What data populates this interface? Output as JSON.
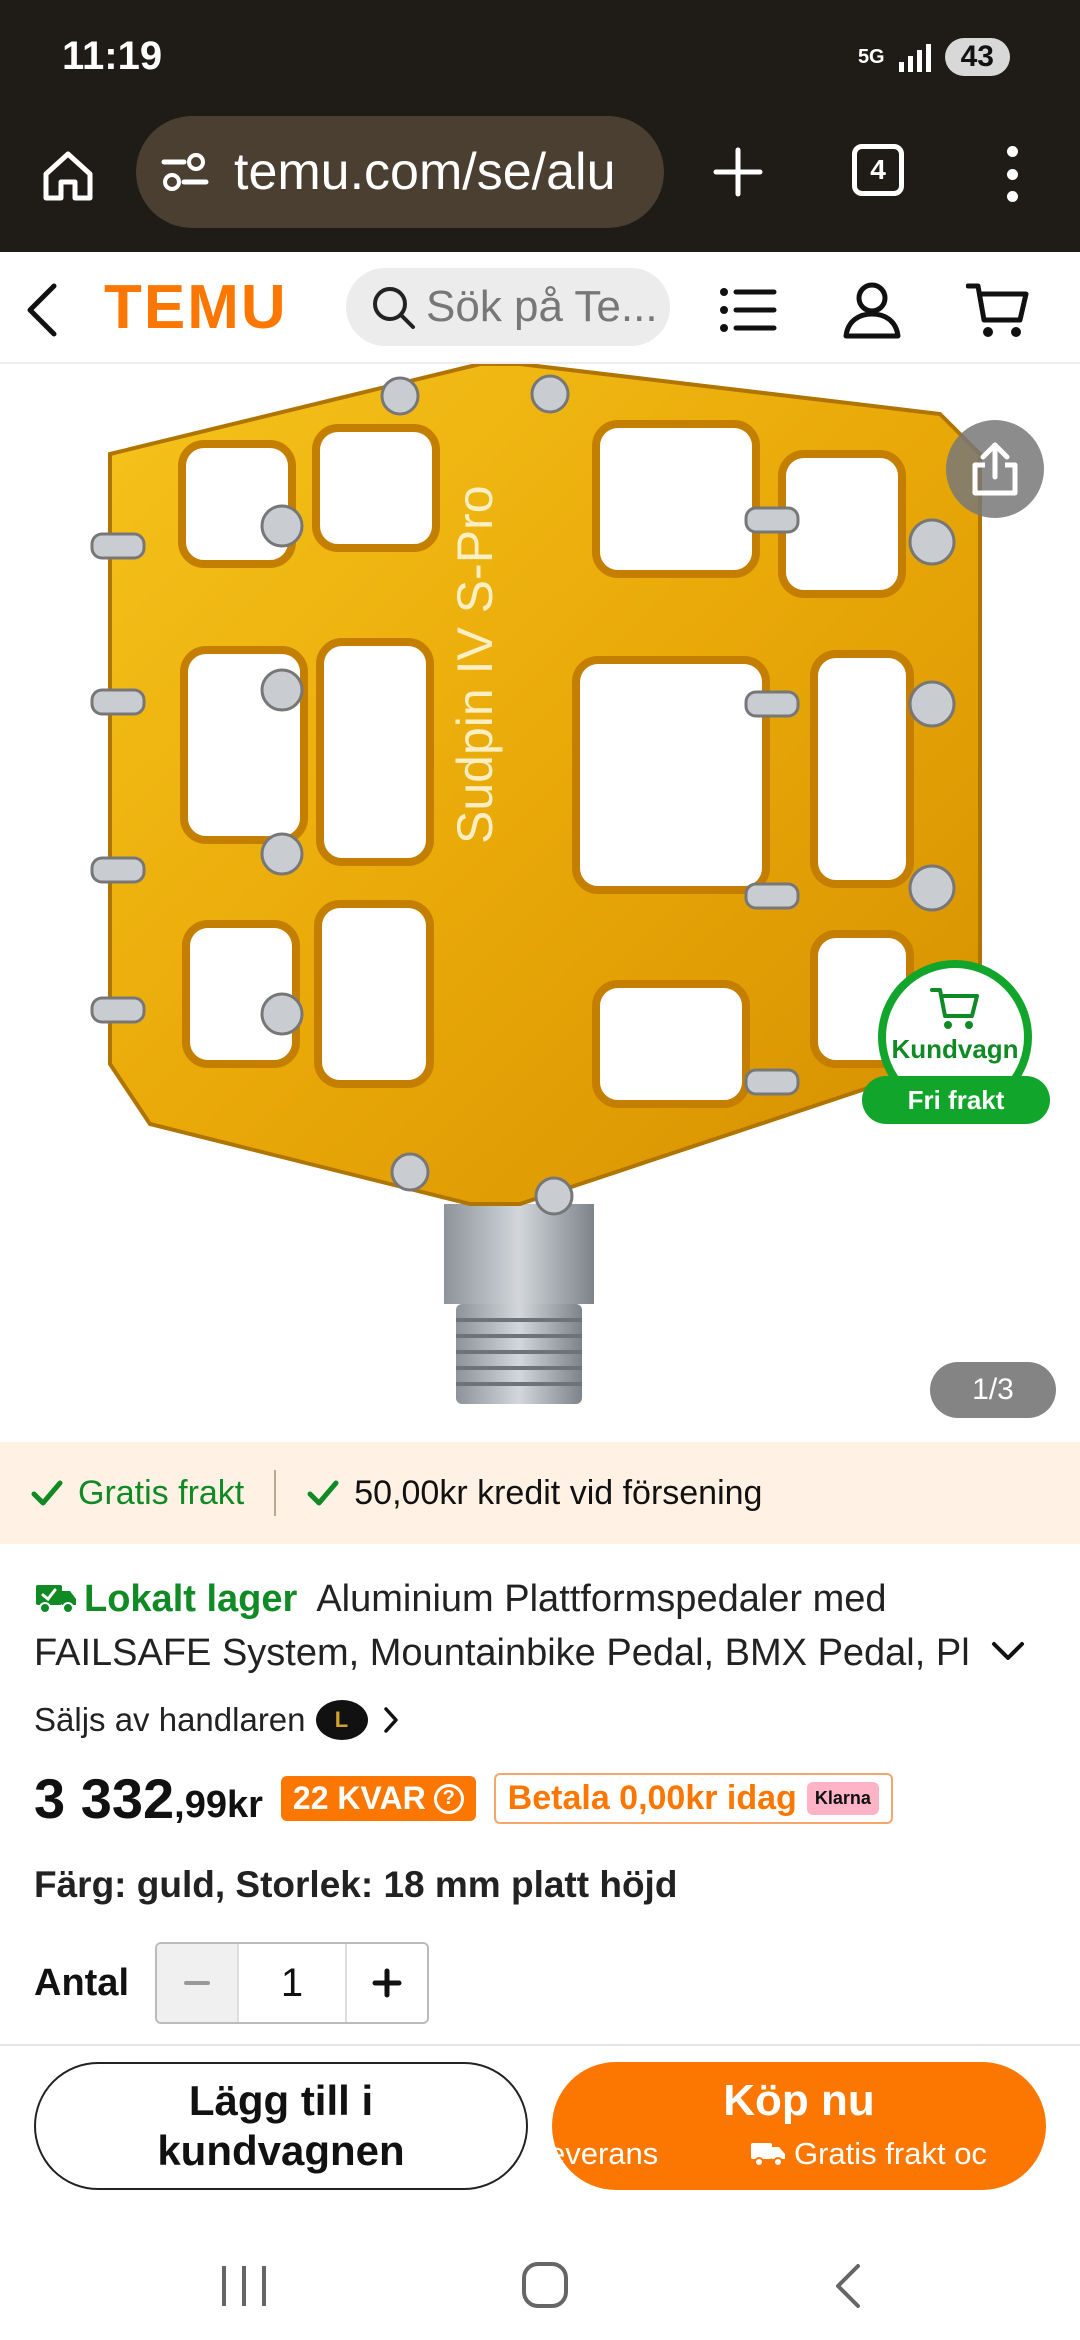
{
  "status_bar": {
    "time": "11:19",
    "network": "5G",
    "battery": "43"
  },
  "browser": {
    "url": "temu.com/se/alu",
    "tab_count": "4"
  },
  "header": {
    "logo": "TEMU",
    "search_placeholder": "Sök på Te..."
  },
  "hero": {
    "counter": "1/3",
    "cart_badge": {
      "label": "Kundvagn",
      "pill": "Fri frakt"
    }
  },
  "info_strip": {
    "item1": "Gratis frakt",
    "item2": "50,00kr kredit vid försening"
  },
  "product": {
    "local_stock": "Lokalt lager",
    "title_line1": "Aluminium Plattformspedaler med",
    "title_line2": "FAILSAFE System, Mountainbike Pedal, BMX Pedal, Pl",
    "seller_label": "Säljs av handlaren",
    "seller_logo_letter": "L",
    "price_main": "3 332",
    "price_decimal": ",99kr",
    "stock_badge": "22 KVAR",
    "pay_badge": "Betala 0,00kr idag",
    "klarna": "Klarna",
    "variant": "Färg: guld, Storlek: 18 mm platt höjd",
    "quantity_label": "Antal",
    "quantity_value": "1"
  },
  "actions": {
    "add_to_cart_line1": "Lägg till i",
    "add_to_cart_line2": "kundvagnen",
    "buy_now": "Köp nu",
    "buy_sub_left": "everans",
    "buy_sub_right": "Gratis frakt oc"
  },
  "colors": {
    "brand": "#fb7701",
    "green": "#0f8a24",
    "chrome": "#1f1b16"
  }
}
